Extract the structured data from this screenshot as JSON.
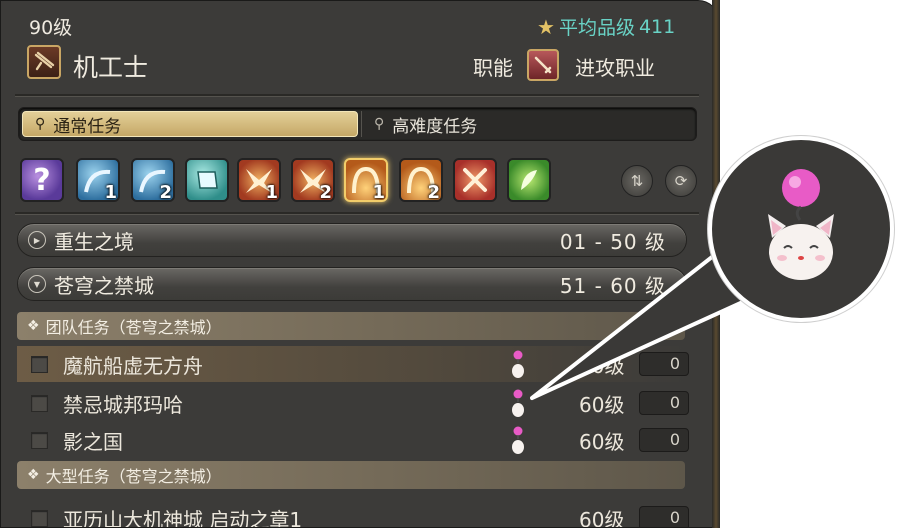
{
  "header": {
    "level": "90级",
    "item_level_label": "平均品级",
    "item_level_value": "411",
    "job_name": "机工士",
    "role_label": "职能",
    "role_name": "进攻职业"
  },
  "tabs": [
    {
      "label": "通常任务",
      "icon": "search-icon",
      "active": true
    },
    {
      "label": "高难度任务",
      "icon": "search-icon",
      "active": false
    }
  ],
  "duty_icons": [
    {
      "icon": "unknown-duty-icon",
      "badge": ""
    },
    {
      "icon": "wave-duty-icon",
      "badge": "1"
    },
    {
      "icon": "wave-duty-icon",
      "badge": "2"
    },
    {
      "icon": "scroll-duty-icon",
      "badge": ""
    },
    {
      "icon": "burst-duty-icon",
      "badge": "1"
    },
    {
      "icon": "burst-duty-icon",
      "badge": "2"
    },
    {
      "icon": "arch-duty-icon",
      "badge": "1",
      "selected": true
    },
    {
      "icon": "arch-duty-icon",
      "badge": "2"
    },
    {
      "icon": "crossed-swords-duty-icon",
      "badge": ""
    },
    {
      "icon": "leaf-duty-icon",
      "badge": ""
    }
  ],
  "categories": [
    {
      "name": "重生之境",
      "range": "01 - 50 级",
      "expanded": false
    },
    {
      "name": "苍穹之禁城",
      "range": "51 - 60 级",
      "expanded": true
    }
  ],
  "sections": [
    {
      "title": "团队任务（苍穹之禁城）"
    },
    {
      "title": "大型任务（苍穹之禁城）"
    }
  ],
  "duties": [
    {
      "name": "魔航船虚无方舟",
      "level": "60级",
      "count": "0",
      "highlight": true
    },
    {
      "name": "禁忌城邦玛哈",
      "level": "60级",
      "count": "0",
      "highlight": false
    },
    {
      "name": "影之国",
      "level": "60级",
      "count": "0",
      "highlight": false
    },
    {
      "name": "亚历山大机神城 启动之章1",
      "level": "60级",
      "count": "0",
      "highlight": false
    }
  ],
  "colors": {
    "panel_bg": "#3c3b39",
    "accent_gold": "#c9a664",
    "ilvl_teal": "#69d3c6",
    "active_tab": "#d9c188",
    "moogle_pom": "#e85bc6"
  }
}
